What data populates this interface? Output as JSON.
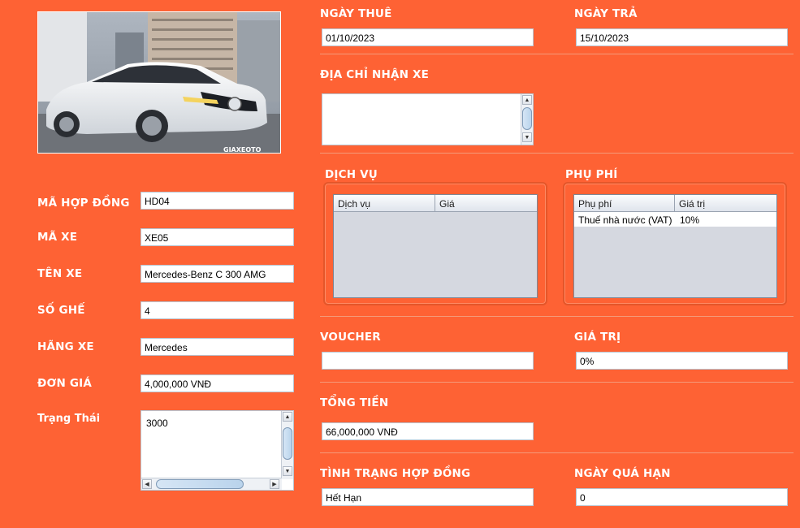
{
  "car": {
    "fields": [
      {
        "label": "MÃ HỢP ĐỒNG",
        "value": "HD04"
      },
      {
        "label": "MÃ XE",
        "value": "XE05"
      },
      {
        "label": "TÊN XE",
        "value": "Mercedes-Benz C 300 AMG"
      },
      {
        "label": "SỐ GHẾ",
        "value": "4"
      },
      {
        "label": "HÃNG XE",
        "value": "Mercedes"
      },
      {
        "label": "ĐƠN GIÁ",
        "value": "4,000,000 VNĐ"
      }
    ],
    "status_label": "Trạng Thái",
    "status_value": "3000",
    "watermark": "GIAXEOTO"
  },
  "rental": {
    "start_label": "NGÀY THUÊ",
    "start_value": "01/10/2023",
    "end_label": "NGÀY TRẢ",
    "end_value": "15/10/2023",
    "address_label": "ĐỊA CHỈ NHẬN XE",
    "address_value": ""
  },
  "services": {
    "title": "DỊCH VỤ",
    "columns": [
      "Dịch vụ",
      "Giá"
    ],
    "rows": []
  },
  "surcharges": {
    "title": "PHỤ PHÍ",
    "columns": [
      "Phụ phí",
      "Giá trị"
    ],
    "rows": [
      [
        "Thuế nhà nước (VAT)",
        "10%"
      ]
    ]
  },
  "voucher": {
    "label": "VOUCHER",
    "value": "",
    "value_label": "GIÁ TRỊ",
    "discount": "0%"
  },
  "total": {
    "label": "TỔNG TIỀN",
    "value": "66,000,000 VNĐ"
  },
  "contract": {
    "status_label": "TÌNH TRẠNG HỢP ĐỒNG",
    "status_value": "Hết Hạn",
    "overdue_label": "NGÀY QUÁ HẠN",
    "overdue_value": "0"
  },
  "colors": {
    "background": "#fe6234",
    "field": "#ffffff",
    "table_bg": "#d5d8e0"
  }
}
